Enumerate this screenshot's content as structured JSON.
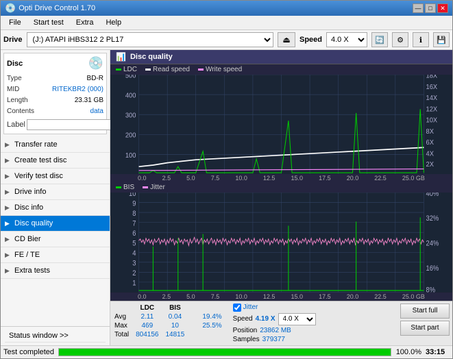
{
  "window": {
    "title": "Opti Drive Control 1.70",
    "icon": "💿",
    "controls": [
      "—",
      "□",
      "✕"
    ]
  },
  "menu": {
    "items": [
      "File",
      "Start test",
      "Extra",
      "Help"
    ]
  },
  "toolbar": {
    "drive_label": "Drive",
    "drive_value": "(J:)  ATAPI iHBS312  2 PL17",
    "speed_label": "Speed",
    "speed_value": "4.0 X"
  },
  "disc": {
    "title": "Disc",
    "type_label": "Type",
    "type_value": "BD-R",
    "mid_label": "MID",
    "mid_value": "RITEKBR2 (000)",
    "length_label": "Length",
    "length_value": "23.31 GB",
    "contents_label": "Contents",
    "contents_value": "data",
    "label_label": "Label",
    "label_placeholder": ""
  },
  "nav": {
    "items": [
      {
        "id": "transfer-rate",
        "label": "Transfer rate",
        "icon": "📈"
      },
      {
        "id": "create-test-disc",
        "label": "Create test disc",
        "icon": "💿"
      },
      {
        "id": "verify-test-disc",
        "label": "Verify test disc",
        "icon": "✔"
      },
      {
        "id": "drive-info",
        "label": "Drive info",
        "icon": "ℹ"
      },
      {
        "id": "disc-info",
        "label": "Disc info",
        "icon": "📋"
      },
      {
        "id": "disc-quality",
        "label": "Disc quality",
        "icon": "⭐",
        "active": true
      },
      {
        "id": "cd-bier",
        "label": "CD Bier",
        "icon": "📊"
      },
      {
        "id": "fe-te",
        "label": "FE / TE",
        "icon": "📉"
      },
      {
        "id": "extra-tests",
        "label": "Extra tests",
        "icon": "🔬"
      }
    ]
  },
  "disc_quality": {
    "title": "Disc quality",
    "legend_top": [
      {
        "label": "LDC",
        "color": "#00cc00"
      },
      {
        "label": "Read speed",
        "color": "#ffffff"
      },
      {
        "label": "Write speed",
        "color": "#ff88ff"
      }
    ],
    "legend_bottom": [
      {
        "label": "BIS",
        "color": "#00cc00"
      },
      {
        "label": "Jitter",
        "color": "#ff88ff"
      }
    ],
    "y_axis_top_right": [
      "18X",
      "16X",
      "14X",
      "12X",
      "10X",
      "8X",
      "6X",
      "4X",
      "2X"
    ],
    "y_axis_top_left": [
      "500",
      "400",
      "300",
      "200",
      "100"
    ],
    "y_axis_bottom_right": [
      "40%",
      "32%",
      "24%",
      "16%",
      "8%"
    ],
    "y_axis_bottom_left": [
      "10",
      "9",
      "8",
      "7",
      "6",
      "5",
      "4",
      "3",
      "2",
      "1"
    ],
    "x_axis": [
      "0.0",
      "2.5",
      "5.0",
      "7.5",
      "10.0",
      "12.5",
      "15.0",
      "17.5",
      "20.0",
      "22.5",
      "25.0 GB"
    ]
  },
  "stats": {
    "columns": [
      "",
      "LDC",
      "BIS",
      "Jitter",
      "Speed",
      "Position",
      "Samples"
    ],
    "avg_label": "Avg",
    "avg_ldc": "2.11",
    "avg_bis": "0.04",
    "avg_jitter": "19.4%",
    "avg_speed": "4.19 X",
    "max_label": "Max",
    "max_ldc": "469",
    "max_bis": "10",
    "max_jitter": "25.5%",
    "max_position": "23862 MB",
    "total_label": "Total",
    "total_ldc": "804156",
    "total_bis": "14815",
    "total_samples": "379377",
    "speed_select": "4.0 X",
    "jitter_checked": true,
    "jitter_label": "Jitter"
  },
  "buttons": {
    "start_full": "Start full",
    "start_part": "Start part"
  },
  "status": {
    "window_label": "Status window >>",
    "status_text": "Test completed",
    "progress": 100,
    "progress_text": "100.0%",
    "time": "33:15"
  }
}
